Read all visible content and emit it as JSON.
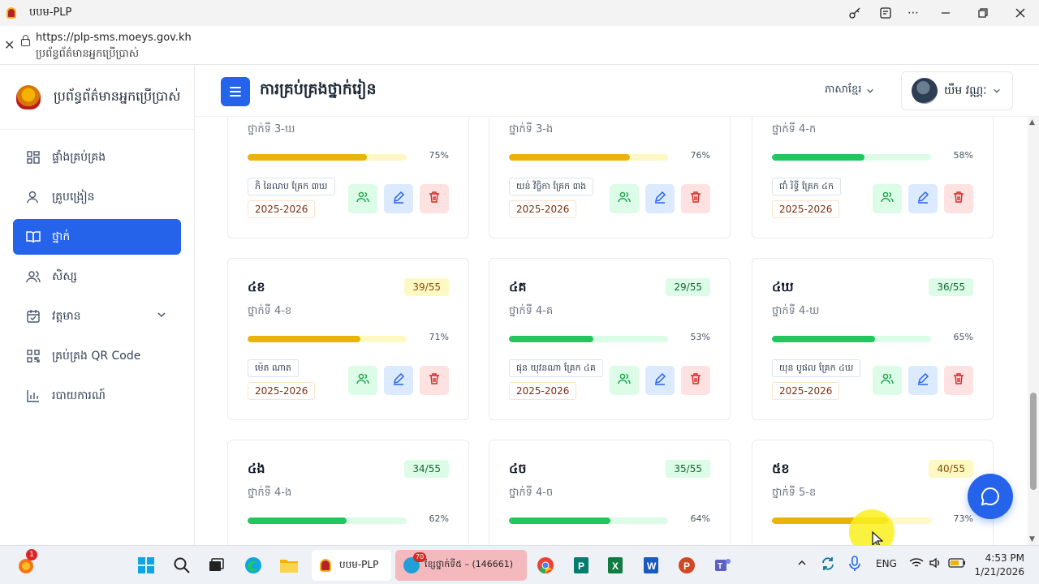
{
  "window": {
    "title": "បបម-PLP"
  },
  "address": {
    "url": "https://plp-sms.moeys.gov.kh",
    "page_name": "ប្រព័ន្ធព័ត៌មានអ្នកប្រើប្រាស់"
  },
  "sidebar": {
    "brand": "ប្រព័ន្ធព័ត៌មានអ្នកប្រើប្រាស់",
    "items": [
      {
        "label": "ផ្ទាំងគ្រប់គ្រង",
        "icon": "dashboard-icon"
      },
      {
        "label": "គ្រូបង្រៀន",
        "icon": "teacher-icon"
      },
      {
        "label": "ថ្នាក់",
        "icon": "book-icon",
        "active": true
      },
      {
        "label": "សិស្ស",
        "icon": "students-icon"
      },
      {
        "label": "វត្តមាន",
        "icon": "calendar-icon",
        "expandable": true
      },
      {
        "label": "គ្រប់គ្រង QR Code",
        "icon": "qr-icon"
      },
      {
        "label": "របាយការណ៍",
        "icon": "report-icon"
      }
    ]
  },
  "header": {
    "title": "ការគ្រប់គ្រងថ្នាក់រៀន",
    "language": "ភាសាខ្មែរ",
    "user_name": "យឹម វណ្ណៈ"
  },
  "cards": [
    {
      "code": "",
      "count": "",
      "grade": "ថ្នាក់ទី 3-ឃ",
      "progress": 75,
      "pct": "75%",
      "color": "yellow",
      "teacher": "ភិ នៃលាប គ្រែក ៣ឃ",
      "year": "2025-2026"
    },
    {
      "code": "",
      "count": "",
      "grade": "ថ្នាក់ទី 3-ង",
      "progress": 76,
      "pct": "76%",
      "color": "yellow",
      "teacher": "យន់ វិច្ចិកា គ្រែក ៣ង",
      "year": "2025-2026"
    },
    {
      "code": "",
      "count": "",
      "grade": "ថ្នាក់ទី 4-ក",
      "progress": 58,
      "pct": "58%",
      "color": "green",
      "teacher": "ជាំ រិទ្ធី គ្រែក ៤ក",
      "year": "2025-2026"
    },
    {
      "code": "៤ខ",
      "count": "39/55",
      "grade": "ថ្នាក់ទី 4-ខ",
      "progress": 71,
      "pct": "71%",
      "color": "yellow",
      "teacher": "ម៉េត ណាត",
      "year": "2025-2026"
    },
    {
      "code": "៤គ",
      "count": "29/55",
      "grade": "ថ្នាក់ទី 4-គ",
      "progress": 53,
      "pct": "53%",
      "color": "green",
      "teacher": "ផុន យុវនណា គ្រែក ៤គ",
      "year": "2025-2026"
    },
    {
      "code": "៤ឃ",
      "count": "36/55",
      "grade": "ថ្នាក់ទី 4-ឃ",
      "progress": 65,
      "pct": "65%",
      "color": "green",
      "teacher": "យុន បូផល គ្រែក ៤ឃ",
      "year": "2025-2026"
    },
    {
      "code": "៤ង",
      "count": "34/55",
      "grade": "ថ្នាក់ទី 4-ង",
      "progress": 62,
      "pct": "62%",
      "color": "green",
      "teacher": "",
      "year": ""
    },
    {
      "code": "៤ច",
      "count": "35/55",
      "grade": "ថ្នាក់ទី 4-ច",
      "progress": 64,
      "pct": "64%",
      "color": "green",
      "teacher": "",
      "year": ""
    },
    {
      "code": "៥ខ",
      "count": "40/55",
      "grade": "ថ្នាក់ទី 5-ខ",
      "progress": 73,
      "pct": "73%",
      "color": "yellow",
      "teacher": "",
      "year": ""
    }
  ],
  "taskbar": {
    "notification_badge": "1",
    "active_app": "បបម-PLP",
    "telegram_label": "ខ្សែថ្នាក់ទី៥ – (146661)",
    "telegram_badge": "70",
    "language": "ENG",
    "time": "4:53 PM",
    "date": "1/21/2026"
  }
}
